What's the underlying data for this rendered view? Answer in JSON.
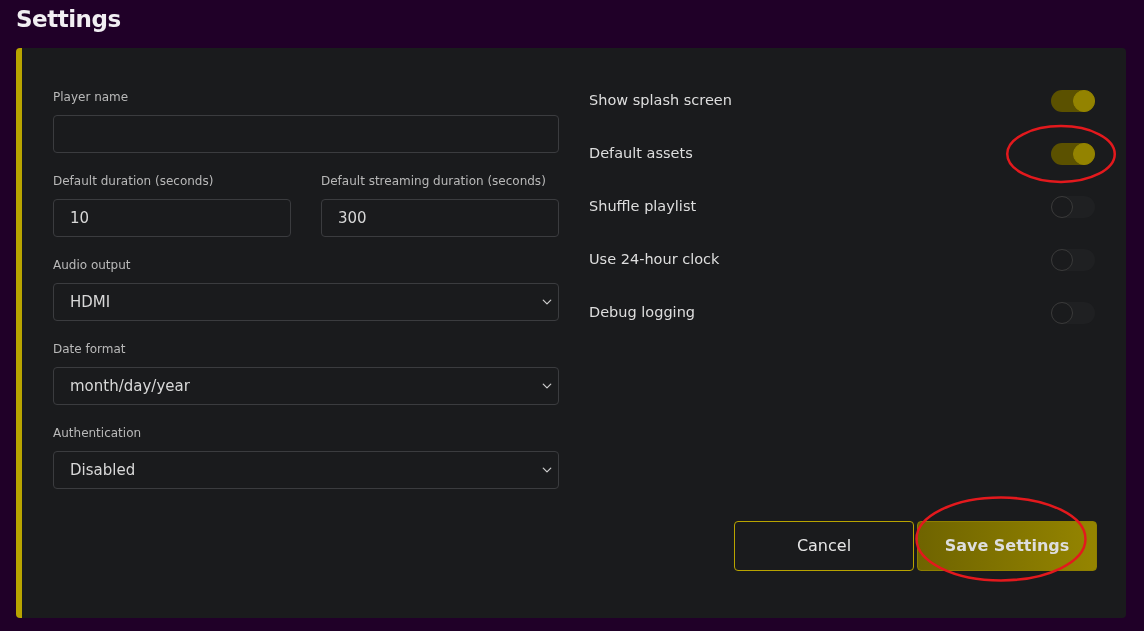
{
  "page": {
    "title": "Settings"
  },
  "form": {
    "fields": [
      {
        "kind": "text",
        "label": "Player name"
      },
      {
        "kind": "text",
        "label": "Default duration (seconds)",
        "value": "10",
        "half": true
      },
      {
        "kind": "text",
        "label": "Default streaming duration (seconds)",
        "value": "300",
        "half": true
      },
      {
        "kind": "select",
        "label": "Audio output",
        "value": "HDMI"
      },
      {
        "kind": "select",
        "label": "Date format",
        "value": "month/day/year"
      },
      {
        "kind": "select",
        "label": "Authentication",
        "value": "Disabled"
      }
    ],
    "toggles": [
      {
        "label": "Show splash screen",
        "on": true
      },
      {
        "label": "Default assets",
        "on": true,
        "circled": true
      },
      {
        "label": "Shuffle playlist",
        "on": false
      },
      {
        "label": "Use 24-hour clock",
        "on": false
      },
      {
        "label": "Debug logging",
        "on": false
      }
    ]
  },
  "buttons": [
    {
      "kind": "secondary",
      "label": "Cancel"
    },
    {
      "kind": "primary",
      "label": "Save Settings",
      "circled": true
    }
  ]
}
